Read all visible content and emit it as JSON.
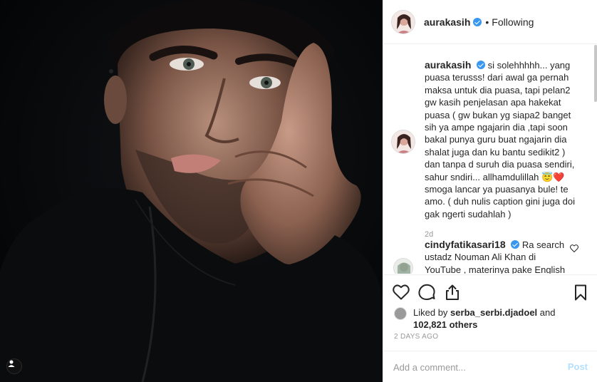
{
  "photo": {
    "alt": ""
  },
  "header": {
    "username": "aurakasih",
    "separator": "•",
    "follow_status": "Following"
  },
  "caption": {
    "username": "aurakasih",
    "text": "si solehhhhh... yang puasa terusss! dari awal ga pernah maksa untuk dia puasa, tapi pelan2 gw kasih penjelasan apa hakekat puasa ( gw bukan yg siapa2 banget sih ya ampe ngajarin dia ,tapi soon bakal punya guru buat ngajarin dia shalat juga dan ku bantu sedikit2 ) dan tanpa d suruh dia puasa sendiri, sahur sndiri... allhamdulillah 😇❤️ smoga lancar ya puasanya bule! te amo. ( duh nulis caption gini juga doi gak ngerti sudahlah )",
    "age": "2d"
  },
  "comment": {
    "username": "cindyfatikasari18",
    "text": "Ra search ustadz Nouman Ali Khan di YouTube , materinya pake English"
  },
  "likes": {
    "prefix": "Liked by",
    "user": "serba_serbi.djadoel",
    "and": "and",
    "others": "102,821 others"
  },
  "timestamp": "2 DAYS AGO",
  "add_comment": {
    "placeholder": "Add a comment...",
    "post_label": "Post"
  },
  "icons": {
    "like": "heart-icon",
    "comment": "comment-icon",
    "share": "share-icon",
    "save": "bookmark-icon",
    "tag": "user-tag-icon"
  },
  "colors": {
    "verified": "#3897f0",
    "post_disabled": "#b2dffc",
    "muted": "#999999",
    "border": "#efefef"
  }
}
